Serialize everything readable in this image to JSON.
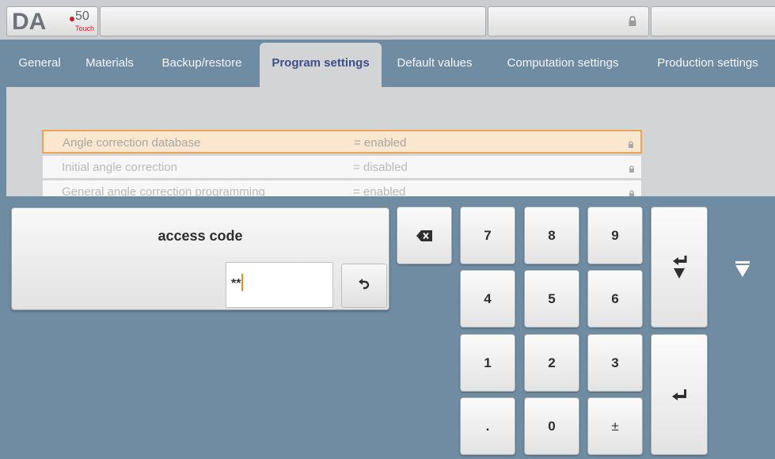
{
  "logo": {
    "brand": "DA",
    "model": "50",
    "edition": "Touch"
  },
  "tabs": [
    {
      "label": "General"
    },
    {
      "label": "Materials"
    },
    {
      "label": "Backup/restore"
    },
    {
      "label": "Program settings"
    },
    {
      "label": "Default values"
    },
    {
      "label": "Computation settings"
    },
    {
      "label": "Production settings"
    }
  ],
  "active_tab": "Program settings",
  "settings": [
    {
      "label": "Angle correction database",
      "value": "= enabled",
      "locked": true,
      "selected": true
    },
    {
      "label": "Initial angle correction",
      "value": "= disabled",
      "locked": true,
      "selected": false
    },
    {
      "label": "General angle correction programming",
      "value": "= enabled",
      "locked": true,
      "selected": false
    }
  ],
  "dialog": {
    "title": "access code",
    "input_value": "**"
  },
  "keypad": {
    "k7": "7",
    "k8": "8",
    "k9": "9",
    "k4": "4",
    "k5": "5",
    "k6": "6",
    "k1": "1",
    "k2": "2",
    "k3": "3",
    "kdot": ".",
    "k0": "0",
    "kpm": "±"
  },
  "icons": {
    "top_lock": "lock-icon",
    "backspace": "backspace-icon",
    "reset": "undo-icon",
    "enter_down": "enter-down-icon",
    "enter": "enter-icon",
    "side_arrow": "triangle-down-icon"
  },
  "colors": {
    "background": "#6f8ca3",
    "active_tab_text": "#3d4f8a",
    "selection_border": "#efa558",
    "caret": "#f08a1c"
  }
}
